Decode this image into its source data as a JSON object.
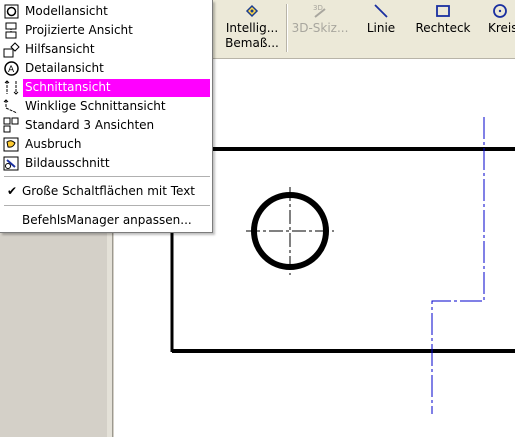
{
  "toolbar": {
    "buttons": [
      {
        "label1": "Intellig...",
        "label2": "Bemaß...",
        "icon": "smart-dimension-icon"
      },
      {
        "label1": "3D-Skiz...",
        "label2": "",
        "icon": "3d-sketch-icon",
        "disabled": true
      },
      {
        "label1": "Linie",
        "label2": "",
        "icon": "line-icon"
      },
      {
        "label1": "Rechteck",
        "label2": "",
        "icon": "rectangle-icon"
      },
      {
        "label1": "Kreis",
        "label2": "",
        "icon": "circle-icon"
      }
    ]
  },
  "menu": {
    "items": [
      {
        "label": "Modellansicht",
        "icon": "model-view-icon"
      },
      {
        "label": "Projizierte Ansicht",
        "icon": "projected-view-icon"
      },
      {
        "label": "Hilfsansicht",
        "icon": "auxiliary-view-icon"
      },
      {
        "label": "Detailansicht",
        "icon": "detail-view-icon"
      },
      {
        "label": "Schnittansicht",
        "icon": "section-view-icon",
        "selected": true
      },
      {
        "label": "Winklige Schnittansicht",
        "icon": "aligned-section-view-icon"
      },
      {
        "label": "Standard 3 Ansichten",
        "icon": "standard-3-views-icon"
      },
      {
        "label": "Ausbruch",
        "icon": "broken-out-icon"
      },
      {
        "label": "Bildausschnitt",
        "icon": "crop-icon"
      }
    ],
    "large_buttons_label": "Große Schaltflächen mit Text",
    "customize_label": "BefehlsManager anpassen..."
  },
  "colors": {
    "highlight": "#ff00ff",
    "drawing_line": "#000000",
    "cut_line": "#0000cc"
  }
}
